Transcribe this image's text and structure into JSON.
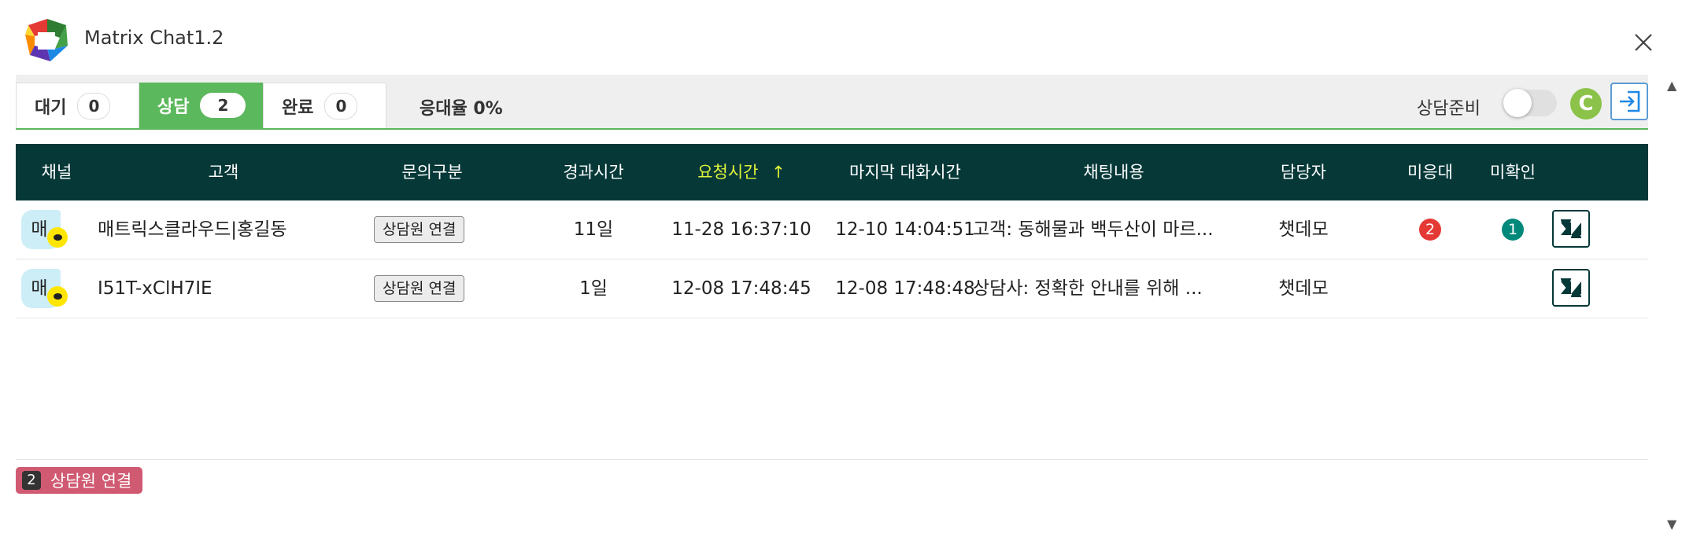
{
  "window": {
    "title": "Matrix Chat1.2",
    "logo_icon": "matrix-chat-logo"
  },
  "tabs": [
    {
      "label": "대기",
      "count": "0"
    },
    {
      "label": "상담",
      "count": "2",
      "active": true
    },
    {
      "label": "완료",
      "count": "0"
    }
  ],
  "toolbar": {
    "response_rate": "응대율 0%",
    "ready_label": "상담준비",
    "ready_toggle_on": false,
    "user_initial": "C",
    "exit_icon": "exit-icon"
  },
  "table": {
    "columns": {
      "channel": "채널",
      "customer": "고객",
      "inquiry": "문의구분",
      "elapsed": "경과시간",
      "requested": "요청시간",
      "last_chat": "마지막 대화시간",
      "content": "채팅내용",
      "agent": "담당자",
      "unanswered": "미응대",
      "unread": "미확인"
    },
    "sort": {
      "column": "요청시간",
      "direction": "asc",
      "arrow": "↑"
    },
    "rows": [
      {
        "channel": "매",
        "customer": "매트릭스클라우드|홍길동",
        "inquiry": "상담원 연결",
        "elapsed": "11일",
        "requested": "11-28 16:37:10",
        "last_chat": "12-10 14:04:51",
        "content": "고객: 동해물과 백두산이 마르...",
        "agent": "챗데모",
        "unanswered": "2",
        "unread": "1"
      },
      {
        "channel": "매",
        "customer": "I51T-xClH7IE",
        "inquiry": "상담원 연결",
        "elapsed": "1일",
        "requested": "12-08 17:48:45",
        "last_chat": "12-08 17:48:48",
        "content": "상담사: 정확한 안내를 위해 ...",
        "agent": "챗데모",
        "unanswered": "",
        "unread": ""
      }
    ]
  },
  "legend": {
    "count": "2",
    "label": "상담원 연결",
    "color": "#d05a72"
  },
  "colors": {
    "accent_green": "#5cb85c",
    "header_bg": "#063838",
    "sorted_header": "#ddf23a",
    "badge_red": "#e53935",
    "badge_teal": "#00897b"
  }
}
